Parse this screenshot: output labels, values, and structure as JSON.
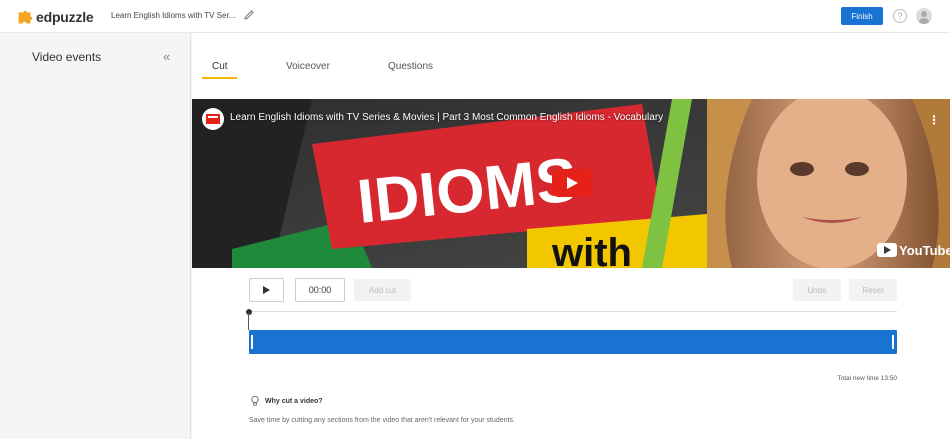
{
  "header": {
    "brand": "edpuzzle",
    "video_title": "Learn English Idioms with TV Ser...",
    "finish_label": "Finish",
    "help_glyph": "?"
  },
  "sidebar": {
    "title": "Video events",
    "collapse_glyph": "«"
  },
  "tabs": [
    {
      "label": "Cut",
      "active": true
    },
    {
      "label": "Voiceover",
      "active": false
    },
    {
      "label": "Questions",
      "active": false
    }
  ],
  "video": {
    "overlay_title": "Learn English Idioms with TV Series & Movies | Part 3 Most Common English Idioms - Vocabulary",
    "banner_word": "IDIOMS",
    "sub_word": "with",
    "youtube_label": "YouTube"
  },
  "controls": {
    "time_value": "00:00",
    "add_cut_label": "Add cut",
    "undo_label": "Undo",
    "reset_label": "Reset"
  },
  "timeline": {
    "total_time_label": "Total new time 13:50"
  },
  "tip": {
    "title": "Why cut a video?",
    "text": "Save time by cutting any sections from the video that aren't relevant for your students."
  },
  "colors": {
    "accent": "#1873d3",
    "tab_underline": "#f4b400",
    "youtube_red": "#e62117"
  }
}
